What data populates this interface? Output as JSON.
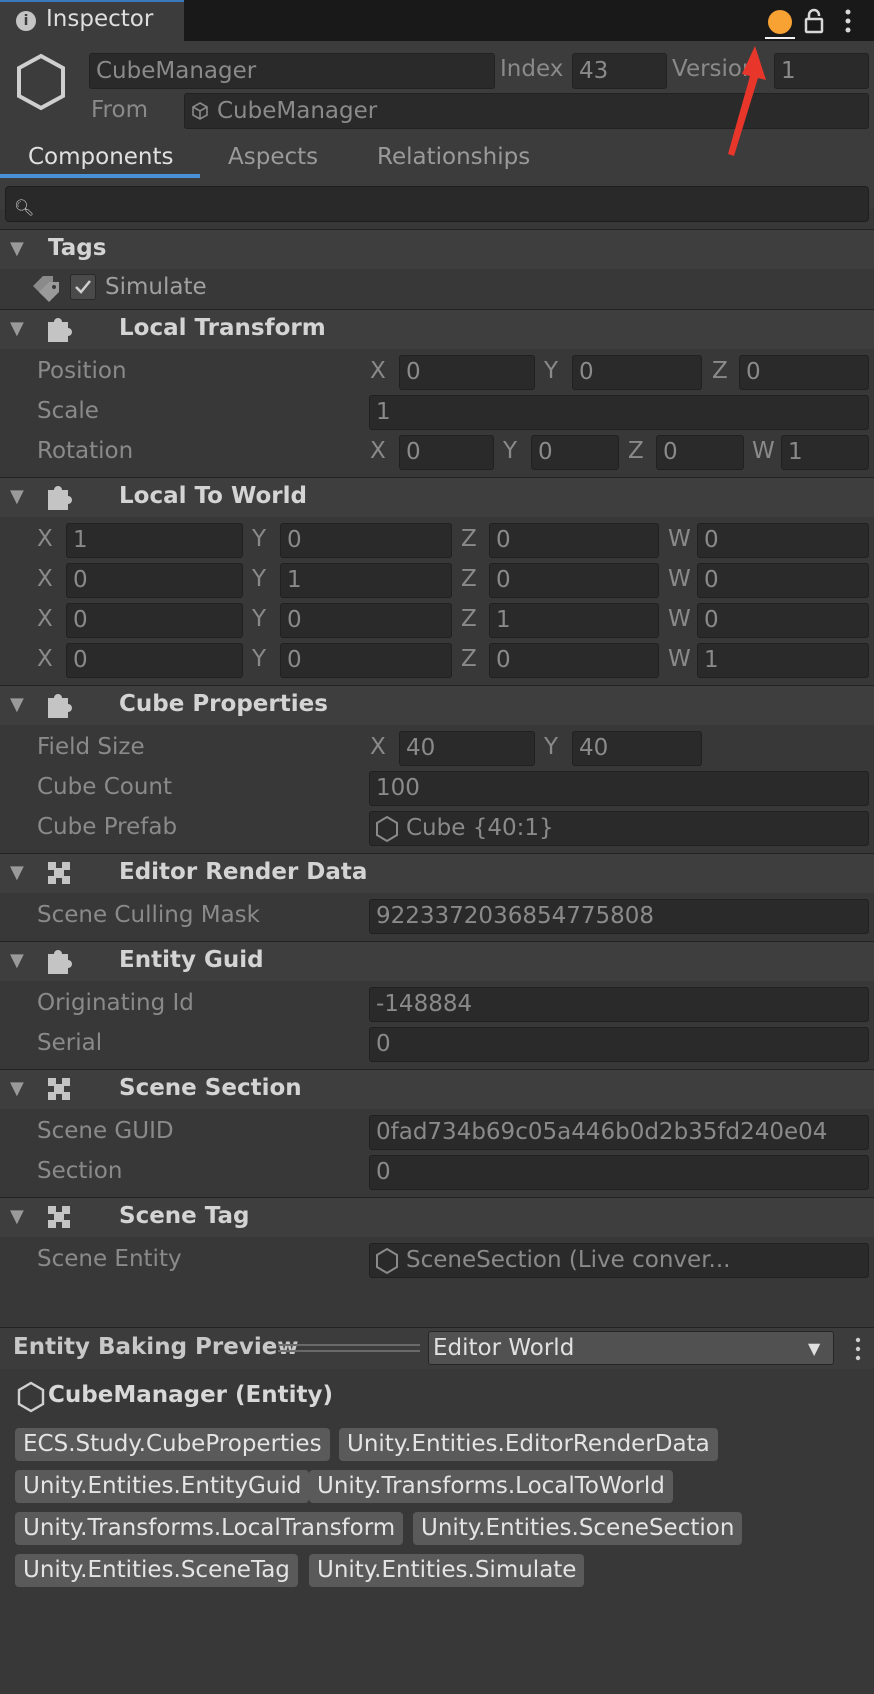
{
  "window": {
    "tab_title": "Inspector",
    "info_icon": "info-icon",
    "status_color": "#f7a233"
  },
  "header": {
    "entity_name": "CubeManager",
    "index_label": "Index",
    "index_value": "43",
    "version_label": "Version",
    "version_value": "1",
    "from_label": "From",
    "from_value": "CubeManager"
  },
  "tabs": [
    {
      "label": "Components",
      "active": true
    },
    {
      "label": "Aspects",
      "active": false
    },
    {
      "label": "Relationships",
      "active": false
    }
  ],
  "search": {
    "value": ""
  },
  "tags": {
    "title": "Tags",
    "items": [
      {
        "label": "Simulate",
        "checked": true
      }
    ]
  },
  "local_transform": {
    "title": "Local Transform",
    "position_label": "Position",
    "position": {
      "x": "0",
      "y": "0",
      "z": "0"
    },
    "scale_label": "Scale",
    "scale": "1",
    "rotation_label": "Rotation",
    "rotation": {
      "x": "0",
      "y": "0",
      "z": "0",
      "w": "1"
    }
  },
  "local_to_world": {
    "title": "Local To World",
    "rows": [
      {
        "x": "1",
        "y": "0",
        "z": "0",
        "w": "0"
      },
      {
        "x": "0",
        "y": "1",
        "z": "0",
        "w": "0"
      },
      {
        "x": "0",
        "y": "0",
        "z": "1",
        "w": "0"
      },
      {
        "x": "0",
        "y": "0",
        "z": "0",
        "w": "1"
      }
    ]
  },
  "cube_properties": {
    "title": "Cube Properties",
    "field_size_label": "Field Size",
    "field_size": {
      "x": "40",
      "y": "40"
    },
    "cube_count_label": "Cube Count",
    "cube_count": "100",
    "cube_prefab_label": "Cube Prefab",
    "cube_prefab": "Cube {40:1}"
  },
  "editor_render_data": {
    "title": "Editor Render Data",
    "scene_culling_mask_label": "Scene Culling Mask",
    "scene_culling_mask": "9223372036854775808"
  },
  "entity_guid": {
    "title": "Entity Guid",
    "originating_id_label": "Originating Id",
    "originating_id": "-148884",
    "serial_label": "Serial",
    "serial": "0"
  },
  "scene_section": {
    "title": "Scene Section",
    "scene_guid_label": "Scene GUID",
    "scene_guid": "0fad734b69c05a446b0d2b35fd240e04",
    "section_label": "Section",
    "section": "0"
  },
  "scene_tag": {
    "title": "Scene Tag",
    "scene_entity_label": "Scene Entity",
    "scene_entity": "SceneSection (Live conver..."
  },
  "axes": {
    "x": "X",
    "y": "Y",
    "z": "Z",
    "w": "W"
  },
  "baking_preview": {
    "title": "Entity Baking Preview",
    "world": "Editor World",
    "entity": "CubeManager (Entity)",
    "components": [
      "ECS.Study.CubeProperties",
      "Unity.Entities.EditorRenderData",
      "Unity.Entities.EntityGuid",
      "Unity.Transforms.LocalToWorld",
      "Unity.Transforms.LocalTransform",
      "Unity.Entities.SceneSection",
      "Unity.Entities.SceneTag",
      "Unity.Entities.Simulate"
    ]
  }
}
